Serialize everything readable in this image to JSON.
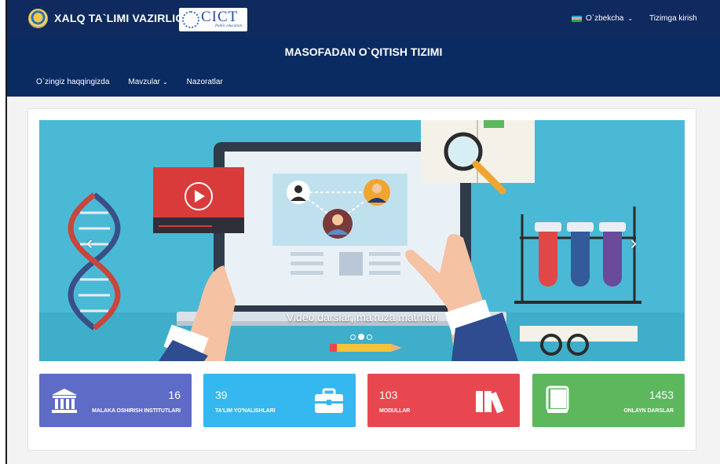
{
  "topbar": {
    "brand_title": "XALQ TA`LIMI VAZIRLIGI",
    "partner_logo_text": "CICT",
    "partner_logo_subtext": "Public education",
    "language": "O`zbekcha",
    "login": "Tizimga kirish"
  },
  "header": {
    "system_title": "MASOFADAN O`QITISH TIZIMI",
    "nav": [
      {
        "label": "O`zingiz haqqingizda",
        "has_dropdown": false
      },
      {
        "label": "Mavzular",
        "has_dropdown": true
      },
      {
        "label": "Nazoratlar",
        "has_dropdown": false
      }
    ]
  },
  "carousel": {
    "caption": "Video darslar, ma'ruza matnlari",
    "slides_count": 3,
    "active_slide": 2,
    "prev_icon": "chevron-left-icon",
    "next_icon": "chevron-right-icon"
  },
  "stats": [
    {
      "value": "16",
      "label": "MALAKA OSHIRISH INSTITUTLARI",
      "icon": "institution-icon",
      "color": "#5e6bc7"
    },
    {
      "value": "39",
      "label": "TA'LIM YO'NALISHLARI",
      "icon": "briefcase-icon",
      "color": "#35b7ef"
    },
    {
      "value": "103",
      "label": "MODULLAR",
      "icon": "books-icon",
      "color": "#e9474f"
    },
    {
      "value": "1453",
      "label": "ONLAYN DARSLAR",
      "icon": "book-icon",
      "color": "#5cb75d"
    }
  ]
}
